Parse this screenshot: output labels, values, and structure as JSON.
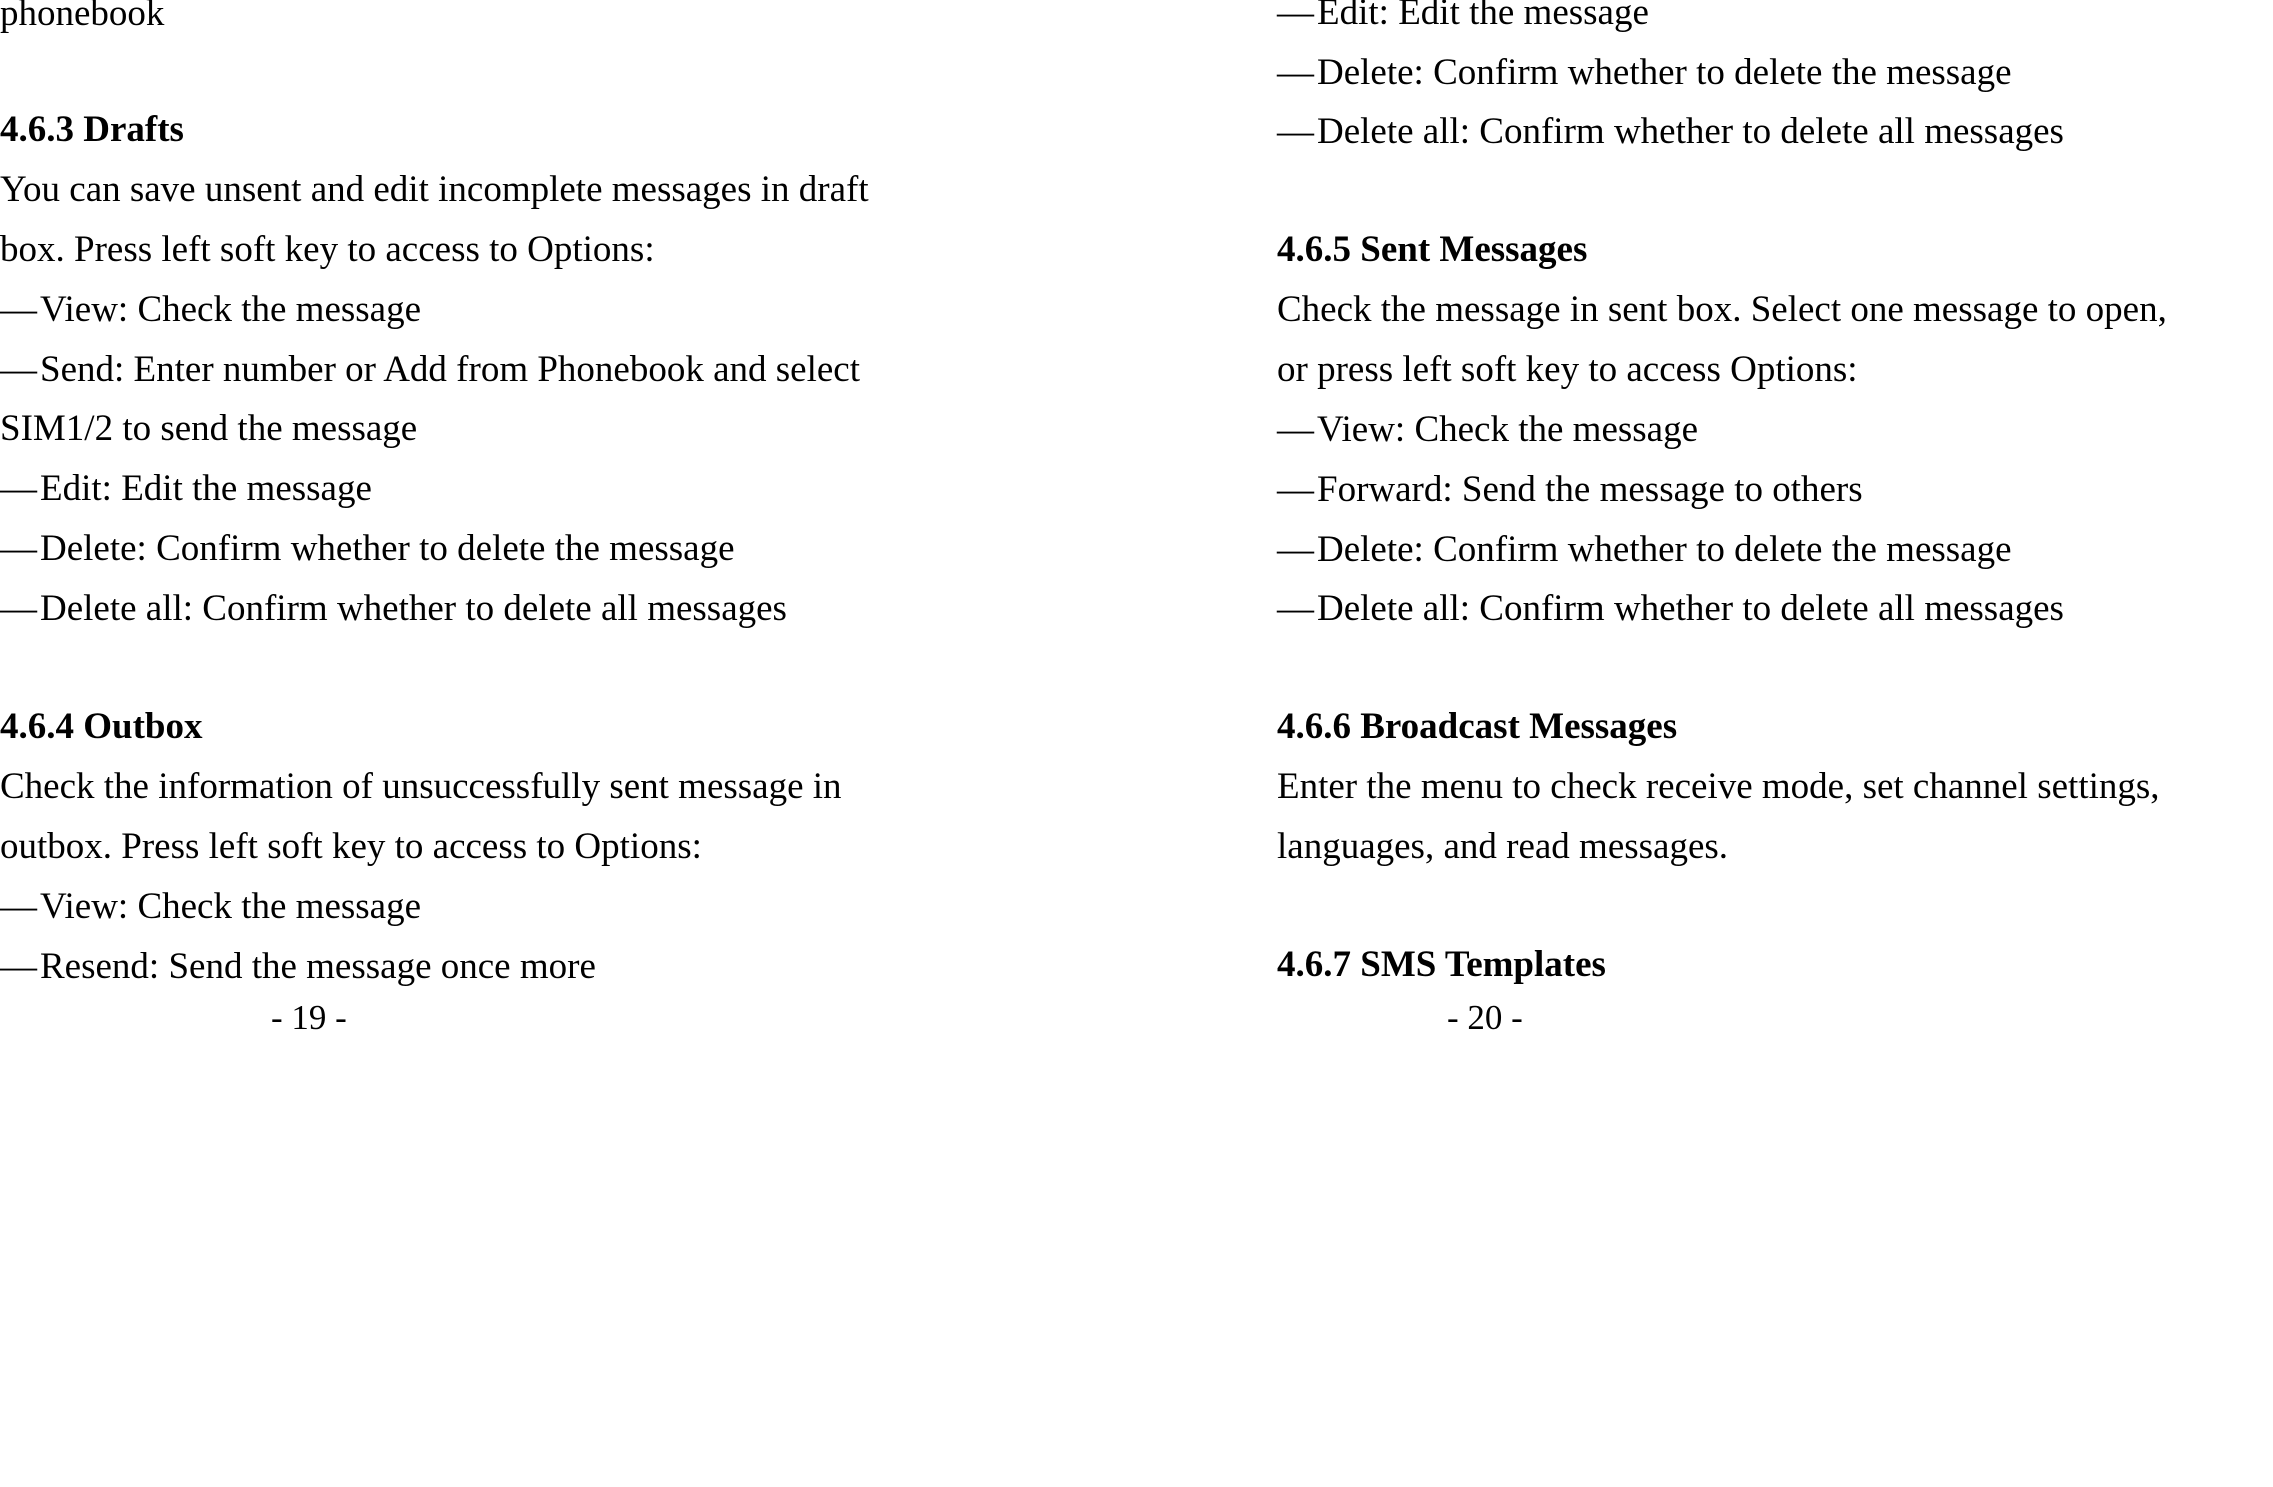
{
  "document": {
    "type": "user-manual-page-spread",
    "left_page": {
      "page_number": "- 19 -",
      "continued_text": "phonebook",
      "sections": [
        {
          "heading": "4.6.3 Drafts",
          "paragraph_lines": [
            "You can save unsent and edit incomplete messages in draft",
            "box. Press left soft key to access to Options:"
          ],
          "bullets": [
            {
              "dash": "—",
              "text": "View: Check the message"
            },
            {
              "dash": "—",
              "text": "Send: Enter number or Add from Phonebook and select"
            },
            {
              "dash": "",
              "text": "SIM1/2 to send the message"
            },
            {
              "dash": "—",
              "text": "Edit: Edit the message"
            },
            {
              "dash": "—",
              "text": "Delete: Confirm whether to delete the message"
            },
            {
              "dash": "—",
              "text": "Delete all: Confirm whether to delete all messages"
            }
          ]
        },
        {
          "heading": "4.6.4 Outbox",
          "paragraph_lines": [
            "Check the information of unsuccessfully sent message in",
            "outbox. Press left soft key to access to Options:"
          ],
          "bullets": [
            {
              "dash": "—",
              "text": "View: Check the message"
            },
            {
              "dash": "—",
              "text": "Resend: Send the message once more"
            }
          ]
        }
      ]
    },
    "right_page": {
      "page_number": "- 20 -",
      "continued_bullets": [
        {
          "dash": "—",
          "text": "Edit: Edit the message"
        },
        {
          "dash": "—",
          "text": "Delete: Confirm whether to delete the message"
        },
        {
          "dash": "—",
          "text": "Delete all: Confirm whether to delete all messages"
        }
      ],
      "sections": [
        {
          "heading": "4.6.5 Sent Messages",
          "paragraph_lines": [
            "Check the message in sent box. Select one message to open,",
            "or press left soft key to access Options:"
          ],
          "bullets": [
            {
              "dash": "—",
              "text": "View: Check the message"
            },
            {
              "dash": "—",
              "text": "Forward: Send the message to others"
            },
            {
              "dash": "—",
              "text": "Delete: Confirm whether to delete the message"
            },
            {
              "dash": "—",
              "text": "Delete all: Confirm whether to delete all messages"
            }
          ]
        },
        {
          "heading": "4.6.6 Broadcast Messages",
          "paragraph_lines": [
            "Enter the menu to check receive mode, set channel settings,",
            "languages, and read messages."
          ],
          "bullets": []
        },
        {
          "heading": "4.6.7 SMS Templates",
          "paragraph_lines": [],
          "bullets": []
        }
      ]
    }
  },
  "left_lines": {
    "l0": "phonebook",
    "l1": "4.6.3 Drafts",
    "l2": "You can save unsent and edit incomplete messages in draft",
    "l3": "box. Press left soft key to access to Options:",
    "l4d": "—",
    "l4": "View: Check the message",
    "l5d": "—",
    "l5": "Send: Enter number or Add from Phonebook and select",
    "l6": "SIM1/2 to send the message",
    "l7d": "—",
    "l7": "Edit: Edit the message",
    "l8d": "—",
    "l8": "Delete: Confirm whether to delete the message",
    "l9d": "—",
    "l9": "Delete all: Confirm whether to delete all messages",
    "l10": "4.6.4 Outbox",
    "l11": "Check the information of unsuccessfully sent message in",
    "l12": "outbox. Press left soft key to access to Options:",
    "l13d": "—",
    "l13": "View: Check the message",
    "l14d": "—",
    "l14": "Resend: Send the message once more",
    "pagenum": "- 19 -"
  },
  "right_lines": {
    "r0d": "—",
    "r0": "Edit: Edit the message",
    "r1d": "—",
    "r1": "Delete: Confirm whether to delete the message",
    "r2d": "—",
    "r2": "Delete all: Confirm whether to delete all messages",
    "r3": "4.6.5 Sent Messages",
    "r4": "Check the message in sent box. Select one message to open,",
    "r5": "or press left soft key to access Options:",
    "r6d": "—",
    "r6": "View: Check the message",
    "r7d": "—",
    "r7": "Forward: Send the message to others",
    "r8d": "—",
    "r8": "Delete: Confirm whether to delete the message",
    "r9d": "—",
    "r9": "Delete all: Confirm whether to delete all messages",
    "r10": "4.6.6 Broadcast Messages",
    "r11": "Enter the menu to check receive mode, set channel settings,",
    "r12": "languages, and read messages.",
    "r13": "4.6.7 SMS Templates",
    "pagenum": "- 20 -"
  }
}
